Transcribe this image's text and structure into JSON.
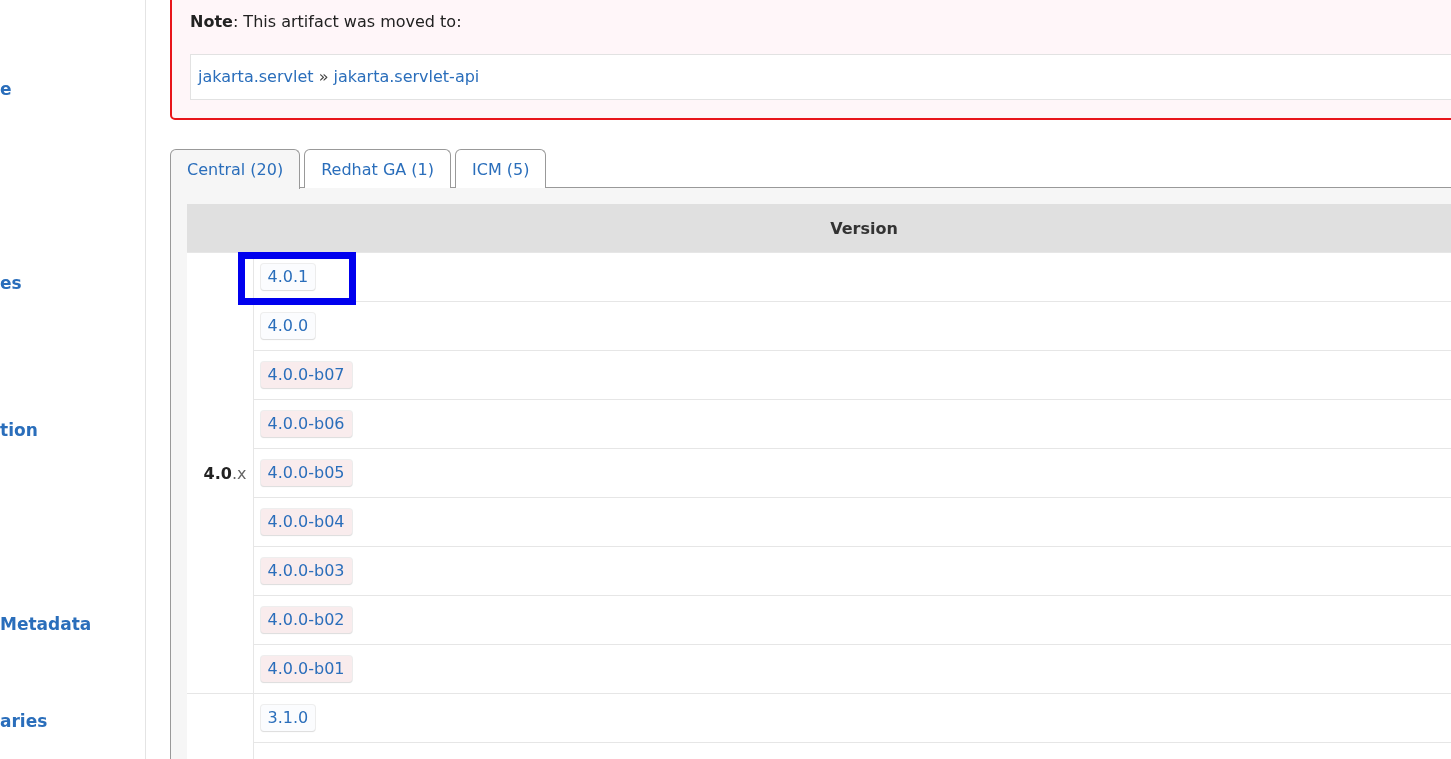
{
  "sidebar": {
    "items": [
      "e",
      "es",
      "tion",
      "Metadata",
      "aries"
    ]
  },
  "note": {
    "label": "Note",
    "text": ": This artifact was moved to:",
    "links": [
      "jakarta.servlet",
      "jakarta.servlet-api"
    ],
    "separator": "»"
  },
  "tabs": [
    {
      "label": "Central (20)",
      "selected": true
    },
    {
      "label": "Redhat GA (1)",
      "selected": false
    },
    {
      "label": "ICM (5)",
      "selected": false
    }
  ],
  "table": {
    "columns": [
      "Version"
    ],
    "groups": [
      {
        "major": "4.0",
        "suffix": ".x",
        "versions": [
          {
            "label": "4.0.1",
            "kind": "release",
            "highlighted": true
          },
          {
            "label": "4.0.0",
            "kind": "release",
            "highlighted": false
          },
          {
            "label": "4.0.0-b07",
            "kind": "beta",
            "highlighted": false
          },
          {
            "label": "4.0.0-b06",
            "kind": "beta",
            "highlighted": false
          },
          {
            "label": "4.0.0-b05",
            "kind": "beta",
            "highlighted": false
          },
          {
            "label": "4.0.0-b04",
            "kind": "beta",
            "highlighted": false
          },
          {
            "label": "4.0.0-b03",
            "kind": "beta",
            "highlighted": false
          },
          {
            "label": "4.0.0-b02",
            "kind": "beta",
            "highlighted": false
          },
          {
            "label": "4.0.0-b01",
            "kind": "beta",
            "highlighted": false
          }
        ]
      },
      {
        "versions": [
          {
            "label": "3.1.0",
            "kind": "release",
            "highlighted": false
          }
        ]
      }
    ]
  }
}
